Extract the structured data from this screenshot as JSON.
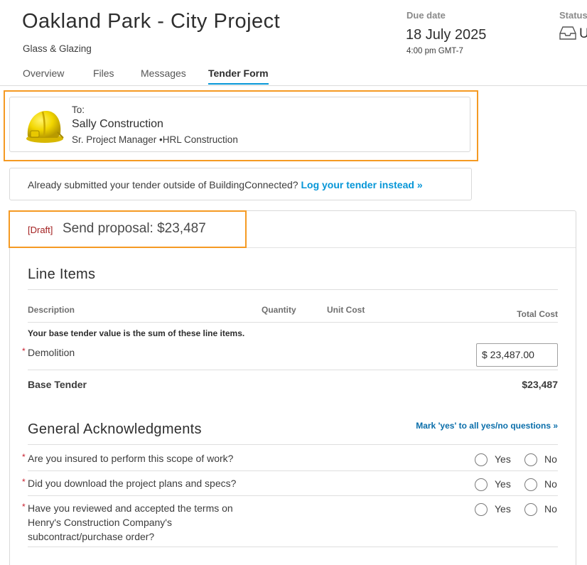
{
  "project": {
    "title": "Oakland Park - City Project",
    "trade": "Glass & Glazing"
  },
  "due": {
    "label": "Due date",
    "date": "18 July 2025",
    "time": "4:00 pm GMT-7"
  },
  "status": {
    "label": "Status",
    "value": "U",
    "icon": "inbox-tray-icon"
  },
  "tabs": [
    {
      "label": "Overview",
      "active": false
    },
    {
      "label": "Files",
      "active": false
    },
    {
      "label": "Messages",
      "active": false
    },
    {
      "label": "Tender Form",
      "active": true
    }
  ],
  "recipient": {
    "to_label": "To:",
    "name": "Sally Construction",
    "role": "Sr. Project Manager •HRL Construction",
    "avatar_icon": "hardhat-icon"
  },
  "already_submitted": {
    "text": "Already submitted your tender outside of BuildingConnected?",
    "link": "Log your tender instead »"
  },
  "proposal": {
    "draft_tag": "[Draft]",
    "title": "Send proposal: $23,487"
  },
  "line_items": {
    "title": "Line Items",
    "columns": {
      "description": "Description",
      "quantity": "Quantity",
      "unit_cost": "Unit Cost",
      "total_cost": "Total Cost"
    },
    "note": "Your base tender value is the sum of these line items.",
    "items": [
      {
        "label": "Demolition",
        "required": true,
        "total_cost": "$ 23,487.00"
      }
    ],
    "base_tender_label": "Base Tender",
    "base_tender_value": "$23,487"
  },
  "acknowledgments": {
    "title": "General Acknowledgments",
    "mark_all": "Mark 'yes' to all yes/no questions »",
    "yes_label": "Yes",
    "no_label": "No",
    "questions": [
      {
        "text": "Are you insured to perform this scope of work?",
        "required": true
      },
      {
        "text": "Did you download the project plans and specs?",
        "required": true
      },
      {
        "text": "Have you reviewed and accepted the terms on Henry's Construction Company's subcontract/purchase order?",
        "required": true
      }
    ]
  },
  "colors": {
    "accent_blue": "#0696d7",
    "highlight_orange": "#f59a23",
    "draft_red": "#a32121",
    "required_red": "#c8202f"
  }
}
